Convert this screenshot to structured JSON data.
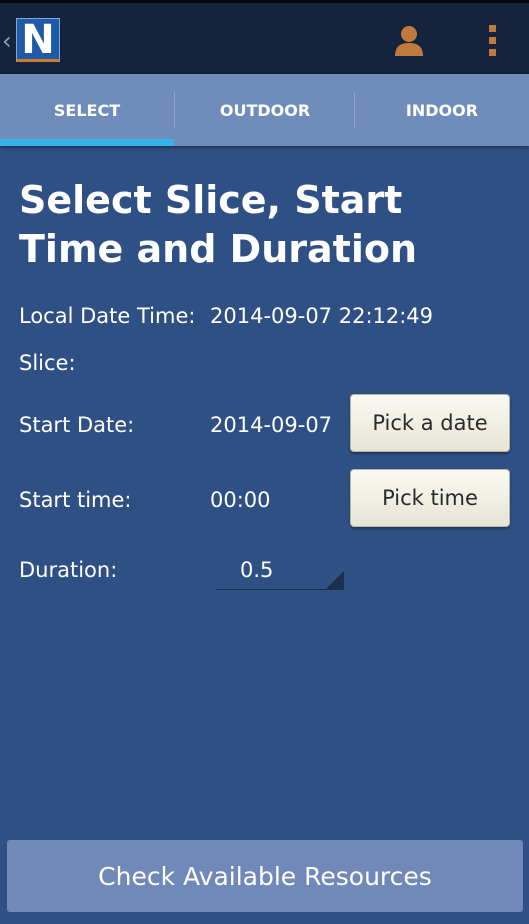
{
  "app": {
    "logo_letter": "N",
    "back_glyph": "‹"
  },
  "tabs": [
    {
      "label": "SELECT",
      "selected": true
    },
    {
      "label": "OUTDOOR",
      "selected": false
    },
    {
      "label": "INDOOR",
      "selected": false
    }
  ],
  "main": {
    "heading": "Select Slice, Start Time and Duration",
    "local_datetime_label": "Local Date Time:",
    "local_datetime_value": "2014-09-07 22:12:49",
    "slice_label": "Slice:",
    "start_date_label": "Start Date:",
    "start_date_value": "2014-09-07",
    "pick_date_label": "Pick a date",
    "start_time_label": "Start time:",
    "start_time_value": "00:00",
    "pick_time_label": "Pick time",
    "duration_label": "Duration:",
    "duration_value": "0.5"
  },
  "footer": {
    "check_button_label": "Check Available Resources"
  },
  "icons": {
    "user": "user-icon",
    "overflow": "overflow-menu-icon"
  },
  "colors": {
    "background": "#2f5085",
    "actionbar": "#14243d",
    "tabbar": "#6f8cbb",
    "tab_indicator": "#35b2e8",
    "accent_orange": "#c07a3d"
  }
}
